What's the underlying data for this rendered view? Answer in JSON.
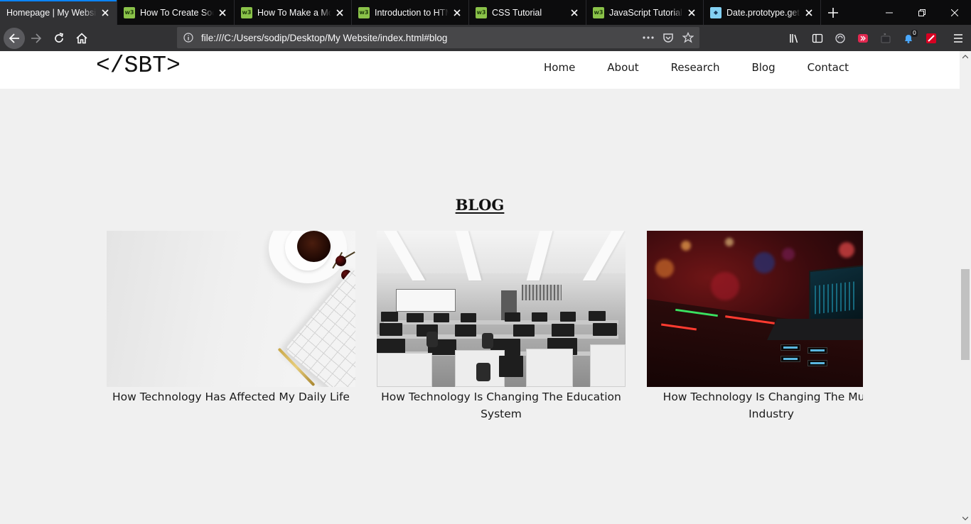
{
  "browser": {
    "tabs": [
      {
        "title": "Homepage | My Website",
        "favicon": "page-icon",
        "active": true
      },
      {
        "title": "How To Create Social Media Buttons",
        "favicon": "w3schools-icon",
        "active": false
      },
      {
        "title": "How To Make a Modal Box",
        "favicon": "w3schools-icon",
        "active": false
      },
      {
        "title": "Introduction to HTML",
        "favicon": "w3schools-icon",
        "active": false
      },
      {
        "title": "CSS Tutorial",
        "favicon": "w3schools-icon",
        "active": false
      },
      {
        "title": "JavaScript Tutorial",
        "favicon": "w3schools-icon",
        "active": false
      },
      {
        "title": "Date.prototype.getFullYear()",
        "favicon": "mdn-icon",
        "active": false
      }
    ],
    "url": "file:///C:/Users/sodip/Desktop/My Website/index.html#blog",
    "notification_badge": "0",
    "colors": {
      "tab_strip": "#0c0c0d",
      "toolbar": "#323234",
      "urlbar": "#474749",
      "active_tab_accent": "#0a84ff"
    }
  },
  "site": {
    "logo": "</SBT>",
    "nav": [
      "Home",
      "About",
      "Research",
      "Blog",
      "Contact"
    ],
    "blog": {
      "heading": "BLOG",
      "posts": [
        {
          "title": "How Technology Has Affected My Daily Life",
          "image": "desk-coffee-keyboard"
        },
        {
          "title": "How Technology Is Changing The Education System",
          "image": "computer-lab"
        },
        {
          "title": "How Technology Is Changing The Music Industry",
          "image": "music-mixer"
        }
      ]
    },
    "colors": {
      "background": "#f0f0f0",
      "header": "#ffffff",
      "text": "#1a1a1a"
    }
  }
}
